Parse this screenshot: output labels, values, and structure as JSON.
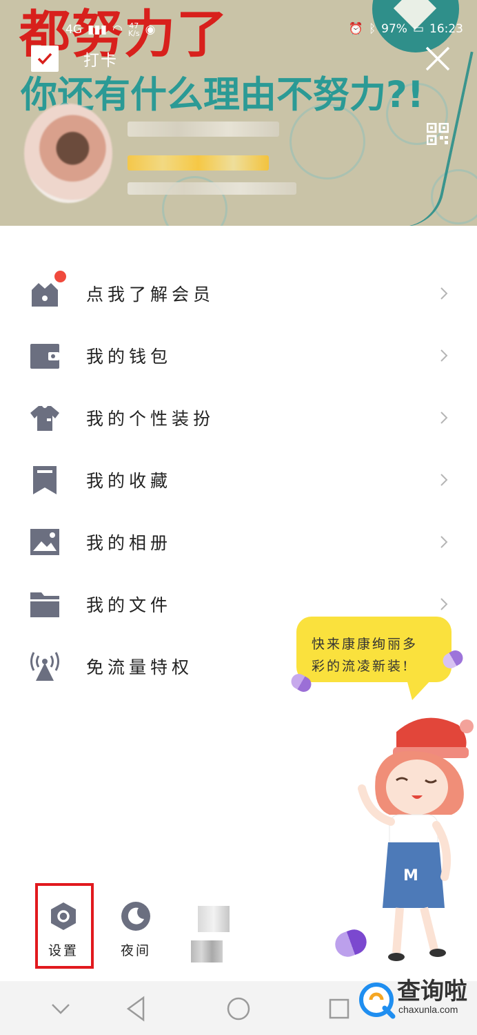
{
  "banner": {
    "red_text": "都努力了",
    "teal_text": "你还有什么理由不努力?!"
  },
  "statusbar": {
    "network": "4G",
    "speed_value": "47",
    "speed_unit": "K/s",
    "battery": "97%",
    "time": "16:23"
  },
  "header": {
    "checkin_label": "打卡"
  },
  "menu": {
    "items": [
      {
        "label": "点我了解会员",
        "icon": "vip-shop-icon",
        "badge": true
      },
      {
        "label": "我的钱包",
        "icon": "wallet-icon"
      },
      {
        "label": "我的个性装扮",
        "icon": "tshirt-icon"
      },
      {
        "label": "我的收藏",
        "icon": "bookmark-icon"
      },
      {
        "label": "我的相册",
        "icon": "photo-icon"
      },
      {
        "label": "我的文件",
        "icon": "folder-icon"
      },
      {
        "label": "免流量特权",
        "icon": "signal-tower-icon"
      }
    ]
  },
  "promo": {
    "bubble_line1": "快来康康绚丽多",
    "bubble_line2": "彩的流凌新装!"
  },
  "toolbar": {
    "settings_label": "设置",
    "night_label": "夜间"
  },
  "watermark": {
    "text": "查询啦",
    "url": "chaxunla.com"
  },
  "colors": {
    "icon_gray": "#6b6f80",
    "badge_red": "#f04a3d",
    "highlight_red": "#e1191e",
    "bubble_yellow": "#fae13d",
    "banner_bg": "#c9c3a7"
  }
}
